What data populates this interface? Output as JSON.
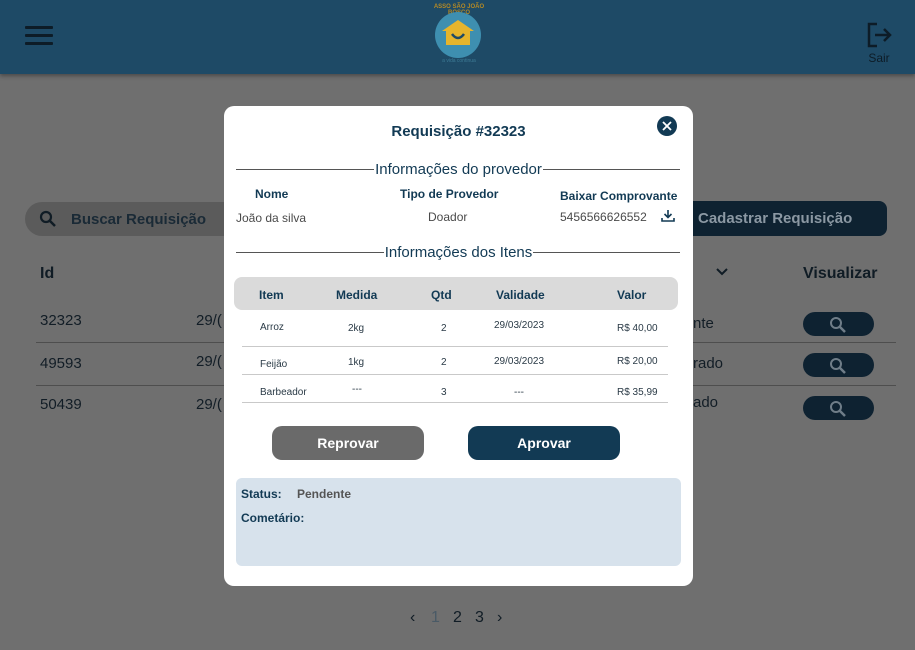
{
  "header": {
    "logo_ring_text": "ASSO SÃO JOÃO BOSCO",
    "logo_subtitle": "a vida continua",
    "logout_label": "Sair"
  },
  "page": {
    "search_placeholder": "Buscar Requisição",
    "register_button": "Cadastrar Requisição",
    "columns": {
      "id": "Id",
      "view": "Visualizar"
    },
    "rows": [
      {
        "id": "32323",
        "date": "29/(",
        "status": "nte"
      },
      {
        "id": "49593",
        "date": "29/(",
        "status": "rado"
      },
      {
        "id": "50439",
        "date": "29/(",
        "status": "ado"
      }
    ],
    "pagination": {
      "prev": "‹",
      "pages": [
        "1",
        "2",
        "3"
      ],
      "next": "›",
      "current": "1"
    }
  },
  "modal": {
    "title": "Requisição #32323",
    "provider_section": "Informações do provedor",
    "provider": {
      "name_label": "Nome",
      "name_value": "João da silva",
      "type_label": "Tipo de Provedor",
      "type_value": "Doador",
      "receipt_label": "Baixar Comprovante",
      "receipt_value": "5456566626552"
    },
    "items_section": "Informações dos Itens",
    "items_columns": {
      "item": "Item",
      "measure": "Medida",
      "qty": "Qtd",
      "validity": "Validade",
      "value": "Valor"
    },
    "items": [
      {
        "item": "Arroz",
        "measure": "2kg",
        "qty": "2",
        "validity": "29/03/2023",
        "value": "R$ 40,00"
      },
      {
        "item": "Feijão",
        "measure": "1kg",
        "qty": "2",
        "validity": "29/03/2023",
        "value": "R$ 20,00"
      },
      {
        "item": "Barbeador",
        "measure": "---",
        "qty": "3",
        "validity": "---",
        "value": "R$ 35,99"
      }
    ],
    "reject_button": "Reprovar",
    "approve_button": "Aprovar",
    "status_label": "Status:",
    "status_value": "Pendente",
    "comment_label": "Cometário:"
  },
  "colors": {
    "header": "#1e4a66",
    "primary": "#123a54",
    "overlay": "#6f6f6f",
    "status_box": "#d7e2ec"
  }
}
